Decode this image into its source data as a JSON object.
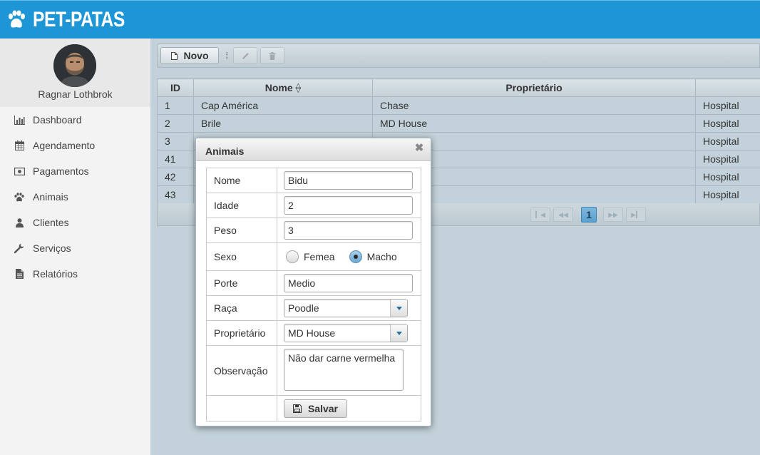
{
  "brand": {
    "name": "PET-PATAS"
  },
  "user": {
    "name": "Ragnar Lothbrok"
  },
  "menu": [
    {
      "label": "Dashboard",
      "icon": "bar-chart-icon"
    },
    {
      "label": "Agendamento",
      "icon": "calendar-icon"
    },
    {
      "label": "Pagamentos",
      "icon": "money-icon"
    },
    {
      "label": "Animais",
      "icon": "paw-icon"
    },
    {
      "label": "Clientes",
      "icon": "user-icon"
    },
    {
      "label": "Serviços",
      "icon": "wrench-icon"
    },
    {
      "label": "Relatórios",
      "icon": "document-icon"
    }
  ],
  "toolbar": {
    "new_label": "Novo"
  },
  "table": {
    "headers": {
      "id": "ID",
      "nome": "Nome",
      "proprietario": "Proprietário",
      "extra": ""
    },
    "rows": [
      {
        "id": "1",
        "nome": "Cap América",
        "proprietario": "Chase",
        "hospital": "Hospital"
      },
      {
        "id": "2",
        "nome": "Brile",
        "proprietario": "MD House",
        "hospital": "Hospital"
      },
      {
        "id": "3",
        "nome": "",
        "proprietario": "",
        "hospital": "Hospital"
      },
      {
        "id": "41",
        "nome": "",
        "proprietario": "",
        "hospital": "Hospital"
      },
      {
        "id": "42",
        "nome": "",
        "proprietario": "",
        "hospital": "Hospital"
      },
      {
        "id": "43",
        "nome": "",
        "proprietario": "",
        "hospital": "Hospital"
      }
    ]
  },
  "pager": {
    "current_page": "1"
  },
  "dialog": {
    "title": "Animais",
    "fields": {
      "nome": {
        "label": "Nome",
        "value": "Bidu"
      },
      "idade": {
        "label": "Idade",
        "value": "2"
      },
      "peso": {
        "label": "Peso",
        "value": "3"
      },
      "sexo": {
        "label": "Sexo",
        "options": [
          "Femea",
          "Macho"
        ],
        "selected": "Macho"
      },
      "porte": {
        "label": "Porte",
        "value": "Medio"
      },
      "raca": {
        "label": "Raça",
        "value": "Poodle"
      },
      "proprietario": {
        "label": "Proprietário",
        "value": "MD House"
      },
      "observacao": {
        "label": "Observação",
        "value": "Não dar carne vermelha"
      }
    },
    "save_label": "Salvar"
  },
  "colors": {
    "header": "#1e95d4",
    "sidebar": "#f3f3f3",
    "content": "#c3d2da",
    "accent": "#5a9fcd"
  }
}
